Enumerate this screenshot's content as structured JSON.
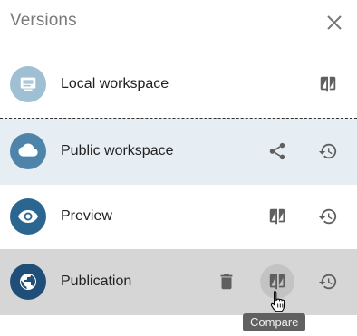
{
  "header": {
    "title": "Versions"
  },
  "versions": [
    {
      "label": "Local workspace"
    },
    {
      "label": "Public workspace"
    },
    {
      "label": "Preview"
    },
    {
      "label": "Publication"
    }
  ],
  "tooltip": {
    "text": "Compare"
  },
  "colors": {
    "avatar_light": "#9fbfd4",
    "avatar_mid": "#4e84aa",
    "avatar_dark": "#2b6690",
    "avatar_darkest": "#1f4f78",
    "selected_row": "#e6edf3",
    "hover_row": "#d6d6d6",
    "icon": "#5f5f5f"
  },
  "icons": [
    "close-icon",
    "monitor-icon",
    "cloud-icon",
    "eye-icon",
    "globe-icon",
    "compare-icon",
    "share-icon",
    "history-icon",
    "delete-icon"
  ]
}
